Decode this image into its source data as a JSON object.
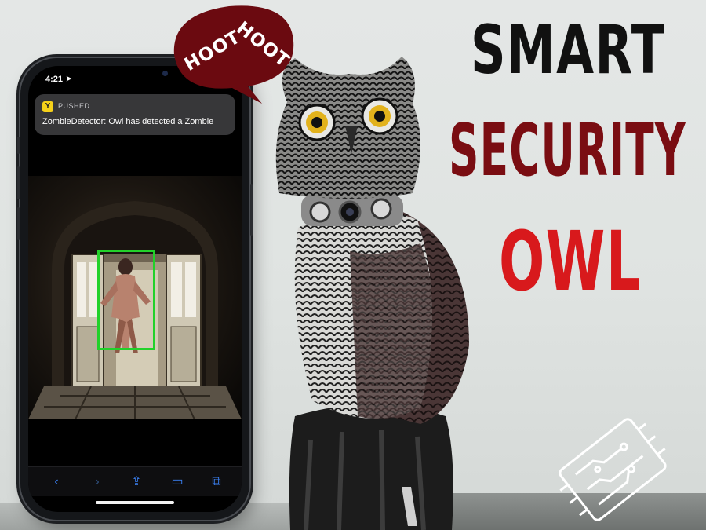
{
  "phone": {
    "status_time": "4:21",
    "status_arrow": "➤",
    "notification": {
      "app_icon": "pushed-app-icon",
      "app_name": "PUSHED",
      "message": "ZombieDetector: Owl has detected a Zombie"
    },
    "photo": {
      "subject": "zombie-figure",
      "detection_box_color": "#22d12a"
    },
    "toolbar": {
      "back_icon": "‹",
      "forward_icon": "›",
      "share_icon": "⇪",
      "bookmarks_icon": "▭",
      "tabs_icon": "⧉"
    }
  },
  "bubble": {
    "line1": "HOOT",
    "line2": "HOOT",
    "color": "#6b0a10"
  },
  "title": {
    "line1": "SMART",
    "line2": "SECURITY",
    "line3": "OWL",
    "colors": [
      "#111111",
      "#7a0d12",
      "#d8191c"
    ]
  },
  "logo_icon": "circuit-board-icon"
}
